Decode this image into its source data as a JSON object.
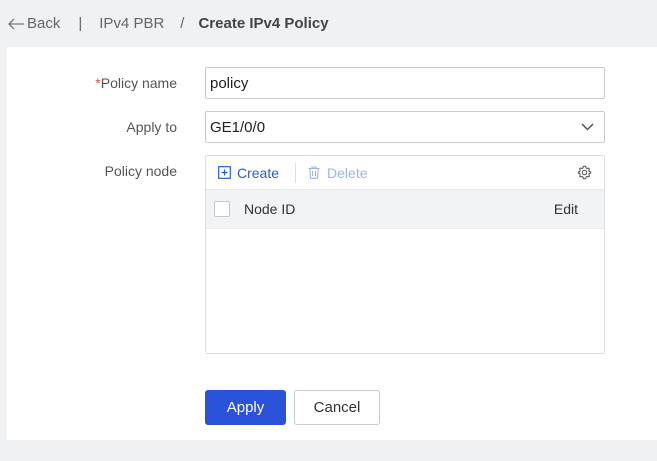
{
  "breadcrumb": {
    "back_label": "Back",
    "separator_bar": "|",
    "parent": "IPv4 PBR",
    "separator_slash": "/",
    "current": "Create IPv4 Policy"
  },
  "form": {
    "policy_name": {
      "required_mark": "*",
      "label": "Policy name",
      "value": "policy"
    },
    "apply_to": {
      "label": "Apply to",
      "value": "GE1/0/0"
    },
    "policy_node": {
      "label": "Policy node",
      "toolbar": {
        "create_label": "Create",
        "delete_label": "Delete"
      },
      "columns": [
        "Node ID",
        "Edit"
      ],
      "rows": []
    }
  },
  "actions": {
    "apply_label": "Apply",
    "cancel_label": "Cancel"
  },
  "colors": {
    "primary": "#2a52d9",
    "link": "#2a5bd7",
    "disabled_link": "#9fb4e6",
    "required": "#d9534f"
  },
  "icons": {
    "back": "arrow-left-icon",
    "dropdown": "chevron-down-icon",
    "create": "plus-square-icon",
    "delete": "trash-icon",
    "settings": "gear-icon"
  }
}
